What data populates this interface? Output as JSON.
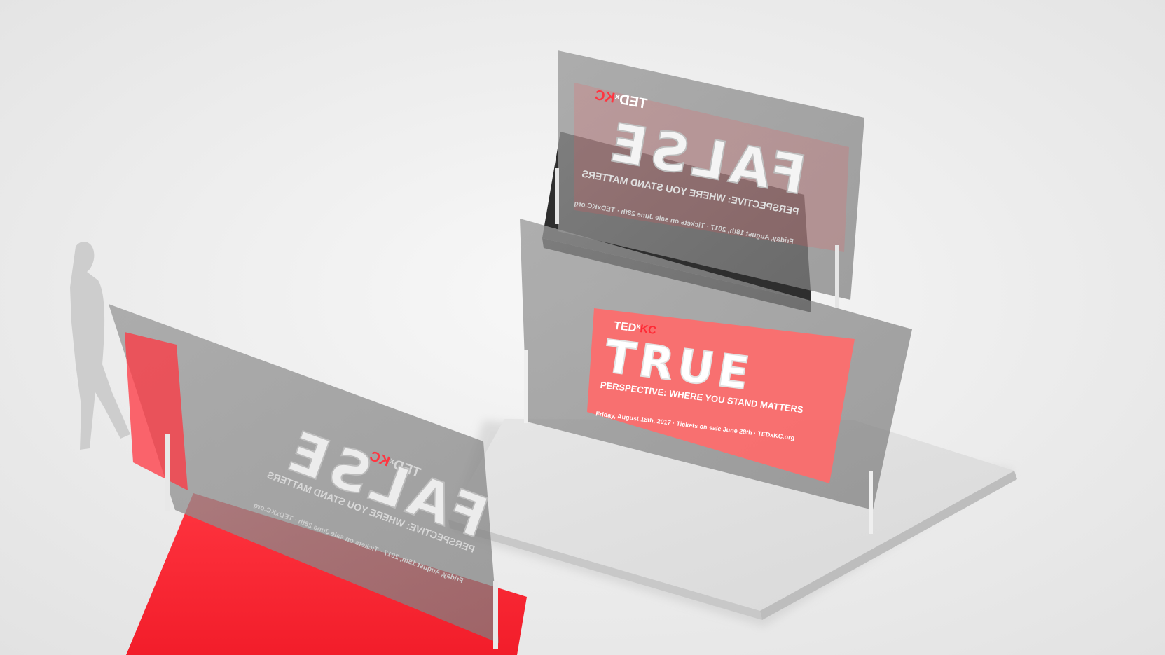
{
  "scene": {
    "colors": {
      "background": "#ececec",
      "platform": "#dcdcdc",
      "glass": "#8a8a8a",
      "red": "#ff2b36",
      "dark": "#2a2a2a",
      "pink": "#ff6b6b"
    },
    "back_panel": {
      "brand_ted": "TED",
      "brand_x": "x",
      "brand_kc": "KC",
      "headline": "FALSE",
      "tagline": "PERSPECTIVE: WHERE YOU STAND MATTERS",
      "details": "Friday, August 18th, 2017 · Tickets on sale June 28th · TEDxKC.org",
      "site": "TEDxKC.org"
    },
    "middle_panel": {
      "brand_ted": "TED",
      "brand_x": "x",
      "brand_kc": "KC",
      "headline": "TRUE",
      "tagline": "PERSPECTIVE: WHERE YOU STAND MATTERS",
      "details": "Friday, August 18th, 2017 · Tickets on sale June 28th · TEDxKC.org"
    },
    "front_panel": {
      "brand_ted": "TED",
      "brand_x": "x",
      "brand_kc": "KC",
      "headline": "FALSE",
      "tagline": "PERSPECTIVE: WHERE YOU STAND MATTERS",
      "details": "Friday, August 18th, 2017 · Tickets on sale June 28th · TEDxKC.org"
    }
  }
}
